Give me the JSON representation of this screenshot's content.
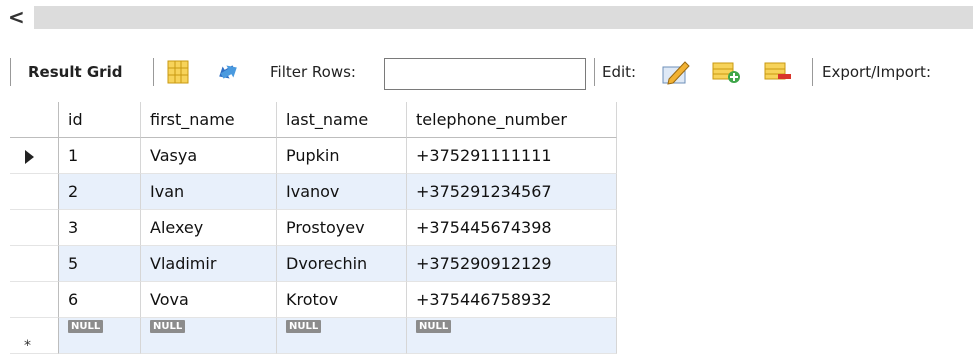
{
  "scrollbar": {
    "left_arrow": "<"
  },
  "toolbar": {
    "result_grid_label": "Result Grid",
    "filter_rows_label": "Filter Rows:",
    "filter_value": "",
    "edit_label": "Edit:",
    "export_import_label": "Export/Import:"
  },
  "grid": {
    "columns": [
      "id",
      "first_name",
      "last_name",
      "telephone_number"
    ],
    "rows": [
      [
        "1",
        "Vasya",
        "Pupkin",
        "+375291111111"
      ],
      [
        "2",
        "Ivan",
        "Ivanov",
        "+375291234567"
      ],
      [
        "3",
        "Alexey",
        "Prostoyev",
        "+375445674398"
      ],
      [
        "5",
        "Vladimir",
        "Dvorechin",
        "+375290912129"
      ],
      [
        "6",
        "Vova",
        "Krotov",
        "+375446758932"
      ]
    ],
    "new_row": [
      "NULL",
      "NULL",
      "NULL",
      "NULL"
    ],
    "new_row_marker": "*"
  },
  "colors": {
    "alt_row": "#e8f0fb",
    "null_badge": "#8c8c8c"
  }
}
